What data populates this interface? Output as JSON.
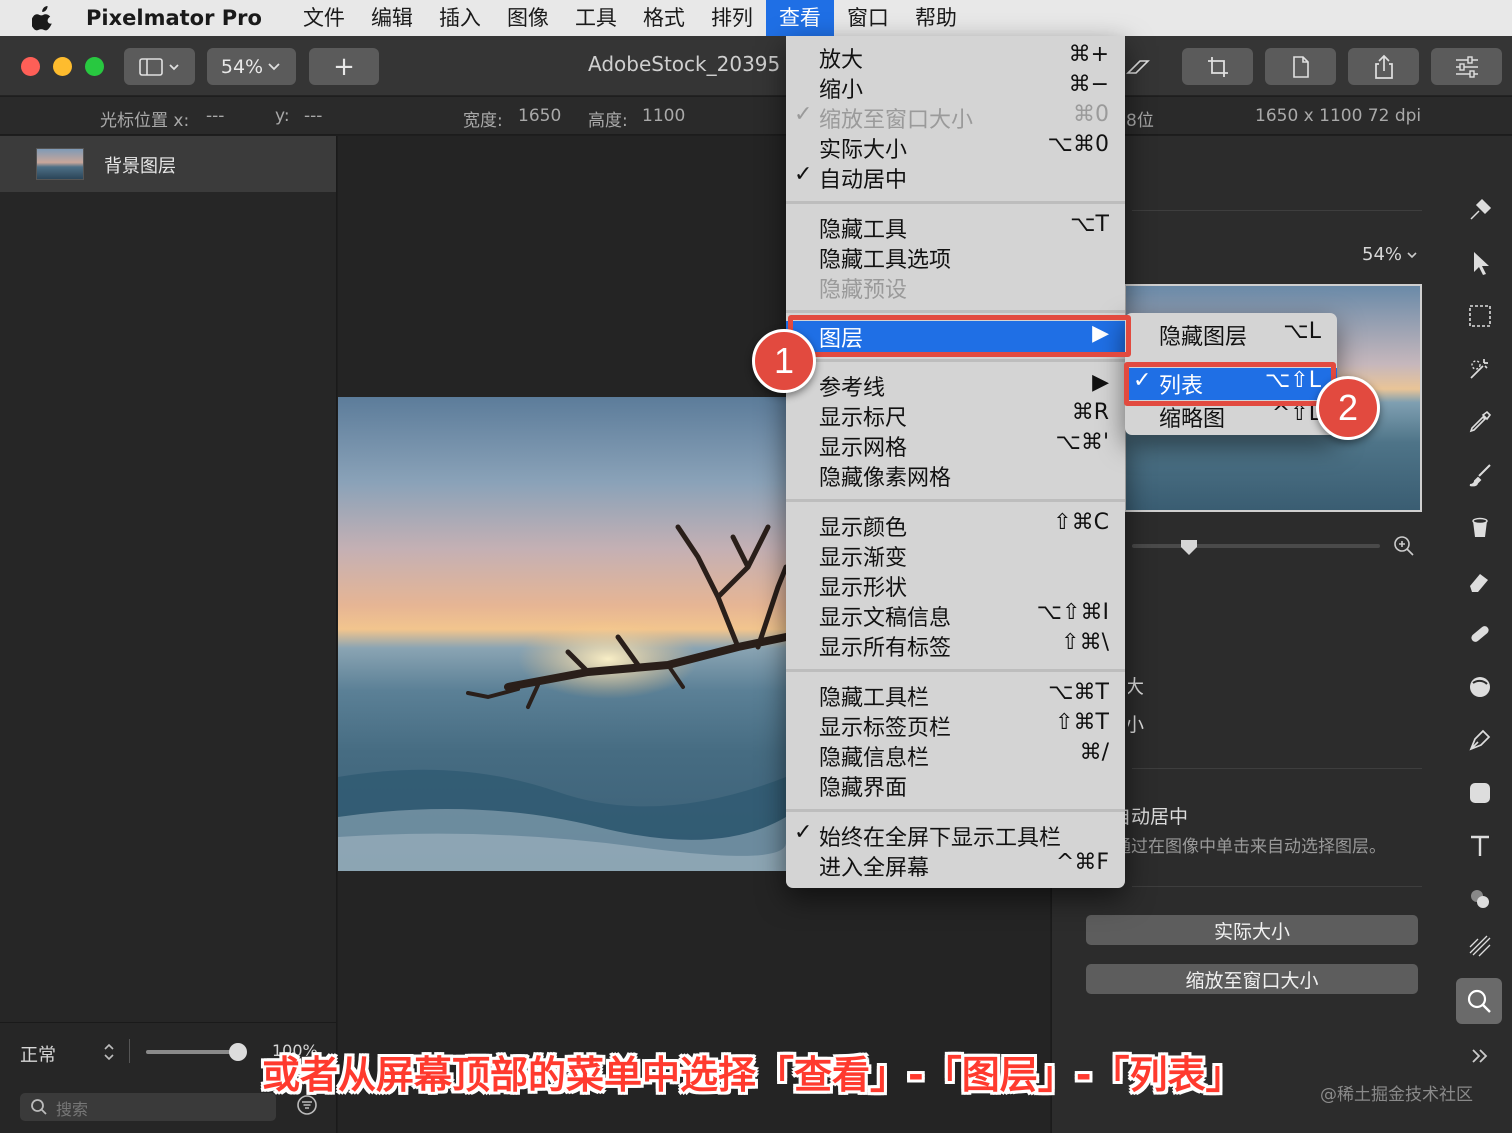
{
  "menubar": {
    "app_name": "Pixelmator Pro",
    "items": [
      "文件",
      "编辑",
      "插入",
      "图像",
      "工具",
      "格式",
      "排列",
      "查看",
      "窗口",
      "帮助"
    ],
    "active_index": 7
  },
  "toolbar": {
    "zoom": "54%",
    "add_label": "+",
    "doc_title": "AdobeStock_20395"
  },
  "infobar": {
    "cursor_label": "光标位置 x:",
    "cursor_x": "---",
    "y_label": "y:",
    "cursor_y": "---",
    "width_label": "宽度:",
    "width": "1650",
    "height_label": "高度:",
    "height": "1100",
    "bits": "8位",
    "size_info": "1650 x 1100 72 dpi"
  },
  "layers": {
    "items": [
      {
        "name": "背景图层"
      }
    ],
    "blend_mode": "正常",
    "opacity": "100%",
    "opacity_fraction": 0.92,
    "search_placeholder": "搜索"
  },
  "view_menu": {
    "items": [
      {
        "label": "放大",
        "shortcut": "⌘+",
        "checked": false,
        "disabled": false
      },
      {
        "label": "缩小",
        "shortcut": "⌘−",
        "checked": false,
        "disabled": false
      },
      {
        "label": "缩放至窗口大小",
        "shortcut": "⌘0",
        "checked": true,
        "disabled": true
      },
      {
        "label": "实际大小",
        "shortcut": "⌥⌘0",
        "checked": false,
        "disabled": false
      },
      {
        "label": "自动居中",
        "shortcut": "",
        "checked": true,
        "disabled": false
      },
      {
        "label": "隐藏工具",
        "shortcut": "⌥T",
        "checked": false,
        "disabled": false
      },
      {
        "label": "隐藏工具选项",
        "shortcut": "",
        "checked": false,
        "disabled": false
      },
      {
        "label": "隐藏预设",
        "shortcut": "",
        "checked": false,
        "disabled": true
      },
      {
        "label": "图层",
        "shortcut": "▶",
        "checked": false,
        "disabled": false,
        "highlighted": true
      },
      {
        "label": "参考线",
        "shortcut": "▶",
        "checked": false,
        "disabled": false
      },
      {
        "label": "显示标尺",
        "shortcut": "⌘R",
        "checked": false,
        "disabled": false
      },
      {
        "label": "显示网格",
        "shortcut": "⌥⌘'",
        "checked": false,
        "disabled": false
      },
      {
        "label": "隐藏像素网格",
        "shortcut": "",
        "checked": false,
        "disabled": false
      },
      {
        "label": "显示颜色",
        "shortcut": "⇧⌘C",
        "checked": false,
        "disabled": false
      },
      {
        "label": "显示渐变",
        "shortcut": "",
        "checked": false,
        "disabled": false
      },
      {
        "label": "显示形状",
        "shortcut": "",
        "checked": false,
        "disabled": false
      },
      {
        "label": "显示文稿信息",
        "shortcut": "⌥⇧⌘I",
        "checked": false,
        "disabled": false
      },
      {
        "label": "显示所有标签",
        "shortcut": "⇧⌘\\",
        "checked": false,
        "disabled": false
      },
      {
        "label": "隐藏工具栏",
        "shortcut": "⌥⌘T",
        "checked": false,
        "disabled": false
      },
      {
        "label": "显示标签页栏",
        "shortcut": "⇧⌘T",
        "checked": false,
        "disabled": false
      },
      {
        "label": "隐藏信息栏",
        "shortcut": "⌘/",
        "checked": false,
        "disabled": false
      },
      {
        "label": "隐藏界面",
        "shortcut": "",
        "checked": false,
        "disabled": false
      },
      {
        "label": "始终在全屏下显示工具栏",
        "shortcut": "",
        "checked": true,
        "disabled": false
      },
      {
        "label": "进入全屏幕",
        "shortcut": "^⌘F",
        "checked": false,
        "disabled": false
      }
    ]
  },
  "layers_submenu": {
    "items": [
      {
        "label": "隐藏图层",
        "shortcut": "⌥L",
        "checked": false
      },
      {
        "label": "列表",
        "shortcut": "⌥⇧L",
        "checked": true,
        "highlighted": true
      },
      {
        "label": "缩略图",
        "shortcut": "^⇧L",
        "checked": false
      }
    ]
  },
  "navigator": {
    "zoom": "54%",
    "zoom_in_label": "放大",
    "zoom_out_label": "缩小",
    "auto_center_label": "自动居中",
    "auto_center_desc": "通过在图像中单击来自动选择图层。",
    "actual_size_button": "实际大小",
    "fit_window_button": "缩放至窗口大小"
  },
  "tools": [
    "style-icon",
    "arrange-icon",
    "selection-icon",
    "magic-wand-icon",
    "color-picker-icon",
    "paint-icon",
    "fill-icon",
    "erase-icon",
    "retouch-icon",
    "distort-icon",
    "pen-icon",
    "shape-icon",
    "type-icon",
    "color-adjust-icon",
    "effects-icon",
    "zoom-icon"
  ],
  "annotations": {
    "step1": "1",
    "step2": "2",
    "caption": "或者从屏幕顶部的菜单中选择「查看」-「图层」-「列表」",
    "accent": "#e24a3f"
  },
  "watermark": "@稀土掘金技术社区",
  "colors": {
    "menu_highlight": "#1f6fe5",
    "close": "#fe5f57",
    "minimize": "#febc2e",
    "zoom": "#28c840"
  }
}
